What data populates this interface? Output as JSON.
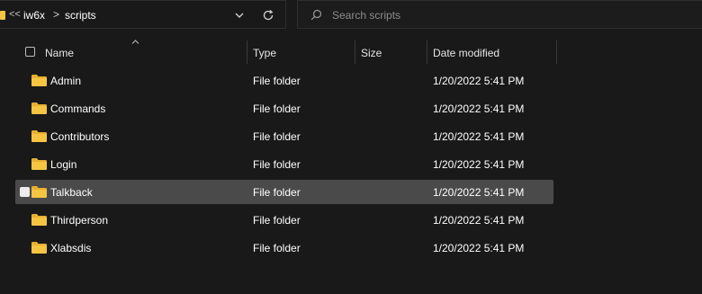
{
  "address": {
    "overflow": "<<",
    "crumbs": [
      "iw6x",
      "scripts"
    ],
    "separator": ">"
  },
  "search": {
    "placeholder": "Search scripts"
  },
  "columns": {
    "name": "Name",
    "type": "Type",
    "size": "Size",
    "date": "Date modified"
  },
  "colors": {
    "folder": "#F5C542",
    "selected_row": "#4A4A4A",
    "background": "#191919"
  },
  "rows": [
    {
      "name": "Admin",
      "type": "File folder",
      "size": "",
      "date": "1/20/2022 5:41 PM",
      "selected": false
    },
    {
      "name": "Commands",
      "type": "File folder",
      "size": "",
      "date": "1/20/2022 5:41 PM",
      "selected": false
    },
    {
      "name": "Contributors",
      "type": "File folder",
      "size": "",
      "date": "1/20/2022 5:41 PM",
      "selected": false
    },
    {
      "name": "Login",
      "type": "File folder",
      "size": "",
      "date": "1/20/2022 5:41 PM",
      "selected": false
    },
    {
      "name": "Talkback",
      "type": "File folder",
      "size": "",
      "date": "1/20/2022 5:41 PM",
      "selected": true
    },
    {
      "name": "Thirdperson",
      "type": "File folder",
      "size": "",
      "date": "1/20/2022 5:41 PM",
      "selected": false
    },
    {
      "name": "Xlabsdis",
      "type": "File folder",
      "size": "",
      "date": "1/20/2022 5:41 PM",
      "selected": false
    }
  ]
}
